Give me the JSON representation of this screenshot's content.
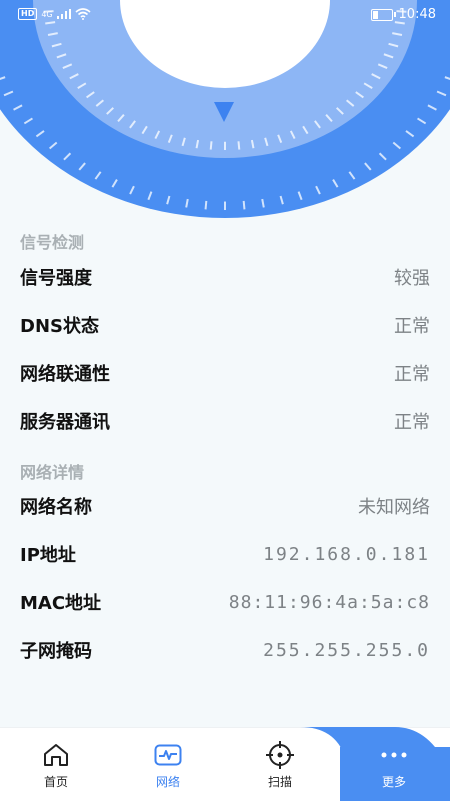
{
  "status_bar": {
    "hd_badge": "HD",
    "network_type": "4G",
    "time": "10:48",
    "battery_level": 0.3
  },
  "colors": {
    "accent": "#3d82f0",
    "gauge_outer": "#4a8ef2",
    "gauge_inner": "#8db6f5",
    "background": "#f4f9fb"
  },
  "signal_section": {
    "title": "信号检测",
    "rows": [
      {
        "label": "信号强度",
        "value": "较强"
      },
      {
        "label": "DNS状态",
        "value": "正常"
      },
      {
        "label": "网络联通性",
        "value": "正常"
      },
      {
        "label": "服务器通讯",
        "value": "正常"
      }
    ]
  },
  "network_section": {
    "title": "网络详情",
    "rows": [
      {
        "label": "网络名称",
        "value": "未知网络"
      },
      {
        "label": "IP地址",
        "value": "192.168.0.181"
      },
      {
        "label": "MAC地址",
        "value": "88:11:96:4a:5a:c8"
      },
      {
        "label": "子网掩码",
        "value": "255.255.255.0"
      }
    ]
  },
  "tabbar": {
    "items": [
      {
        "label": "首页",
        "icon": "home-icon"
      },
      {
        "label": "网络",
        "icon": "pulse-icon"
      },
      {
        "label": "扫描",
        "icon": "crosshair-icon"
      },
      {
        "label": "更多",
        "icon": "more-dots-icon"
      }
    ],
    "active_index": 1
  }
}
